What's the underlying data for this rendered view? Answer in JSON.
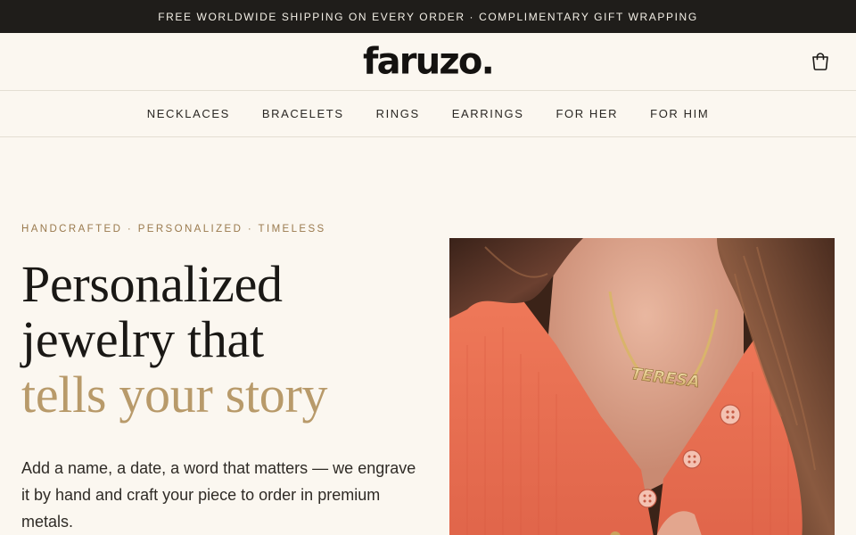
{
  "announcement": "FREE WORLDWIDE SHIPPING ON EVERY ORDER · COMPLIMENTARY GIFT WRAPPING",
  "header": {
    "logo": "faruzo.",
    "cart_icon": "shopping-bag-icon"
  },
  "nav": {
    "items": [
      "NECKLACES",
      "BRACELETS",
      "RINGS",
      "EARRINGS",
      "FOR HER",
      "FOR HIM"
    ]
  },
  "hero": {
    "eyebrow": "HANDCRAFTED · PERSONALIZED · TIMELESS",
    "headline_line1": "Personalized",
    "headline_line2": "jewelry that",
    "headline_accent": "tells your story",
    "description": "Add a name, a date, a word that matters — we engrave it by hand and craft your piece to order in premium metals.",
    "image_pendant_text": "TERESA"
  },
  "colors": {
    "background": "#fbf7f0",
    "announcement_bg": "#1f1d1a",
    "accent_gold": "#b89a6a",
    "eyebrow": "#9a7a4e"
  }
}
